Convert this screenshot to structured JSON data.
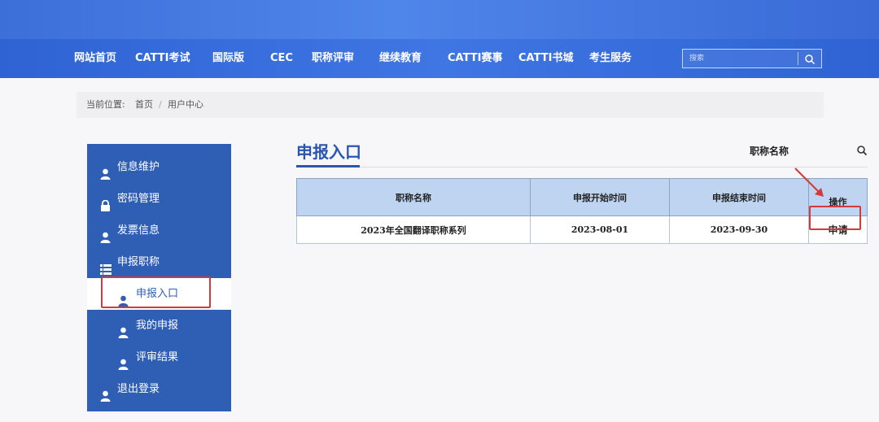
{
  "nav": {
    "items": [
      "网站首页",
      "CATTI考试",
      "国际版",
      "CEC",
      "职称评审",
      "继续教育",
      "CATTI赛事",
      "CATTI书城",
      "考生服务"
    ],
    "search_placeholder": "搜索"
  },
  "breadcrumb": {
    "prefix": "当前位置:",
    "home": "首页",
    "separator": "/",
    "current": "用户中心"
  },
  "sidebar": {
    "items": [
      {
        "label": "信息维护",
        "icon": "user-icon"
      },
      {
        "label": "密码管理",
        "icon": "lock-icon"
      },
      {
        "label": "发票信息",
        "icon": "user-icon"
      },
      {
        "label": "申报职称",
        "icon": "list-icon"
      },
      {
        "label": "申报入口",
        "icon": "user-icon",
        "active": true
      },
      {
        "label": "我的申报",
        "icon": "user-icon"
      },
      {
        "label": "评审结果",
        "icon": "user-icon"
      },
      {
        "label": "退出登录",
        "icon": "user-icon"
      }
    ]
  },
  "main": {
    "title": "申报入口",
    "filter_label": "职称名称",
    "table": {
      "headers": [
        "职称名称",
        "申报开始时间",
        "申报结束时间",
        "操作"
      ],
      "rows": [
        [
          "2023年全国翻译职称系列",
          "2023-08-01",
          "2023-09-30",
          "申请"
        ]
      ]
    }
  },
  "colors": {
    "nav_blue": "#2f63d4",
    "sidebar_blue": "#2f5fb5",
    "table_header": "#bfd4f0",
    "highlight_red": "#d33a3a"
  }
}
